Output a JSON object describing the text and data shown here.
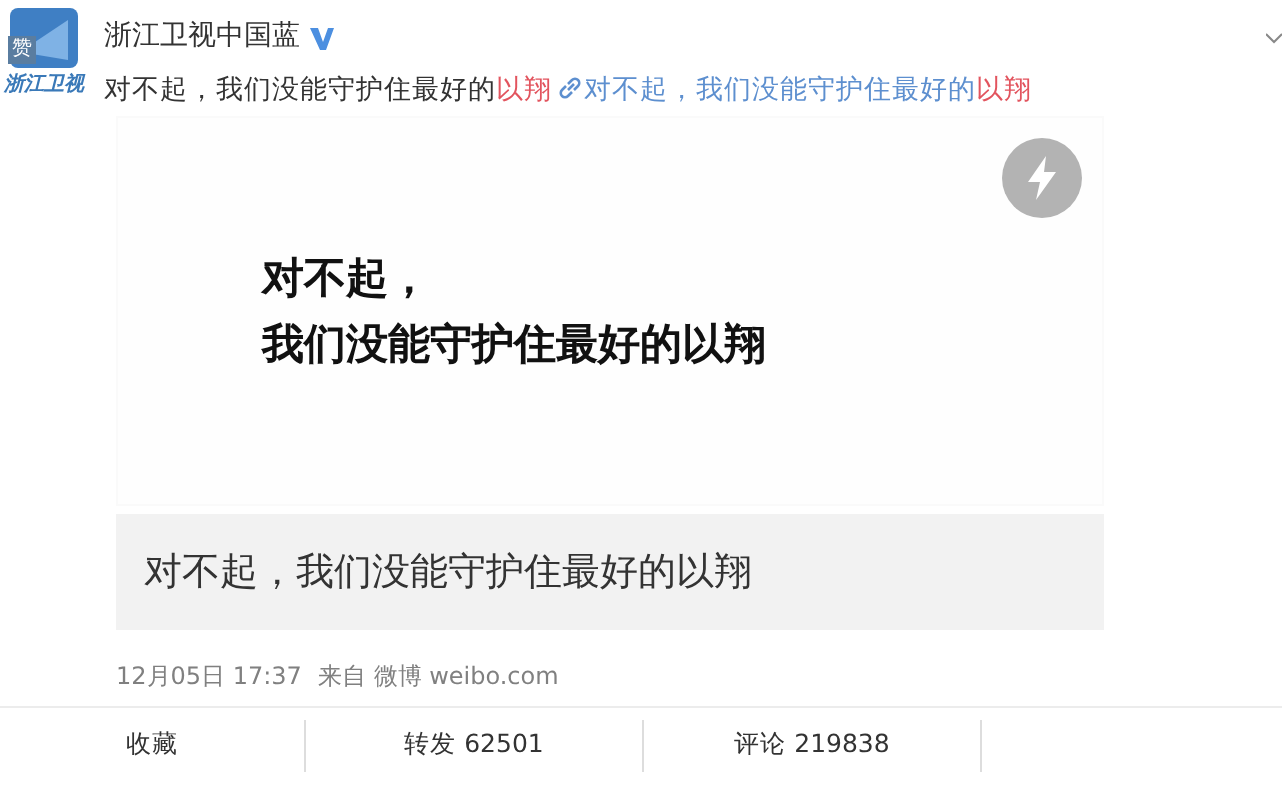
{
  "author": {
    "name": "浙江卫视中国蓝",
    "verified": true,
    "avatar_text": "浙江卫视",
    "badge": "赞"
  },
  "text": {
    "parts": [
      {
        "text": "对不起，我们没能守护住最好的",
        "kind": "plain"
      },
      {
        "text": "以翔",
        "kind": "hashtag"
      },
      {
        "text": "对不起，我们没能守护住最好的",
        "kind": "link"
      },
      {
        "text": "以翔",
        "kind": "hashtag"
      }
    ]
  },
  "video": {
    "caption_lines": [
      "对不起，",
      "我们没能守护住最好的以翔"
    ],
    "title": "对不起，我们没能守护住最好的以翔"
  },
  "meta": {
    "time": "12月05日 17:37",
    "source": "来自 微博 weibo.com"
  },
  "actions": [
    {
      "label": "收藏"
    },
    {
      "label": "转发 62501"
    },
    {
      "label": "评论 219838"
    }
  ]
}
